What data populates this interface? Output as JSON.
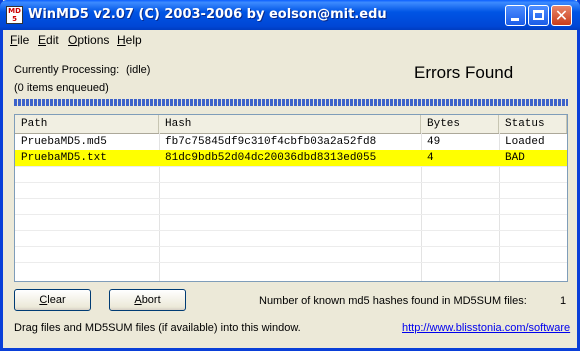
{
  "window": {
    "title": "WinMD5 v2.07 (C) 2003-2006 by eolson@mit.edu",
    "icon_text": [
      "MD",
      "5"
    ]
  },
  "menu": {
    "items": [
      {
        "label": "File",
        "mnemonic": "F"
      },
      {
        "label": "Edit",
        "mnemonic": "E"
      },
      {
        "label": "Options",
        "mnemonic": "O"
      },
      {
        "label": "Help",
        "mnemonic": "H"
      }
    ]
  },
  "status": {
    "processing_label": "Currently Processing:",
    "processing_value": "(idle)",
    "queue": "(0 items enqueued)",
    "result": "Errors Found"
  },
  "list": {
    "columns": [
      "Path",
      "Hash",
      "Bytes",
      "Status"
    ],
    "rows": [
      {
        "path": "PruebaMD5.md5",
        "hash": "fb7c75845df9c310f4cbfb03a2a52fd8",
        "bytes": "49",
        "status": "Loaded",
        "highlight": false
      },
      {
        "path": "PruebaMD5.txt",
        "hash": "81dc9bdb52d04dc20036dbd8313ed055",
        "bytes": "4",
        "status": "BAD",
        "highlight": true
      }
    ]
  },
  "buttons": {
    "clear": "Clear",
    "abort": "Abort"
  },
  "footer": {
    "hash_count_label": "Number of known md5 hashes found in MD5SUM files:",
    "hash_count_value": "1",
    "drag_hint": "Drag files and MD5SUM files (if available) into this window.",
    "link": "http://www.blisstonia.com/software"
  },
  "colors": {
    "titlebar": "#0046d5",
    "highlight_row": "#ffff00",
    "link": "#0000ee",
    "progress": "#3d62c9"
  }
}
